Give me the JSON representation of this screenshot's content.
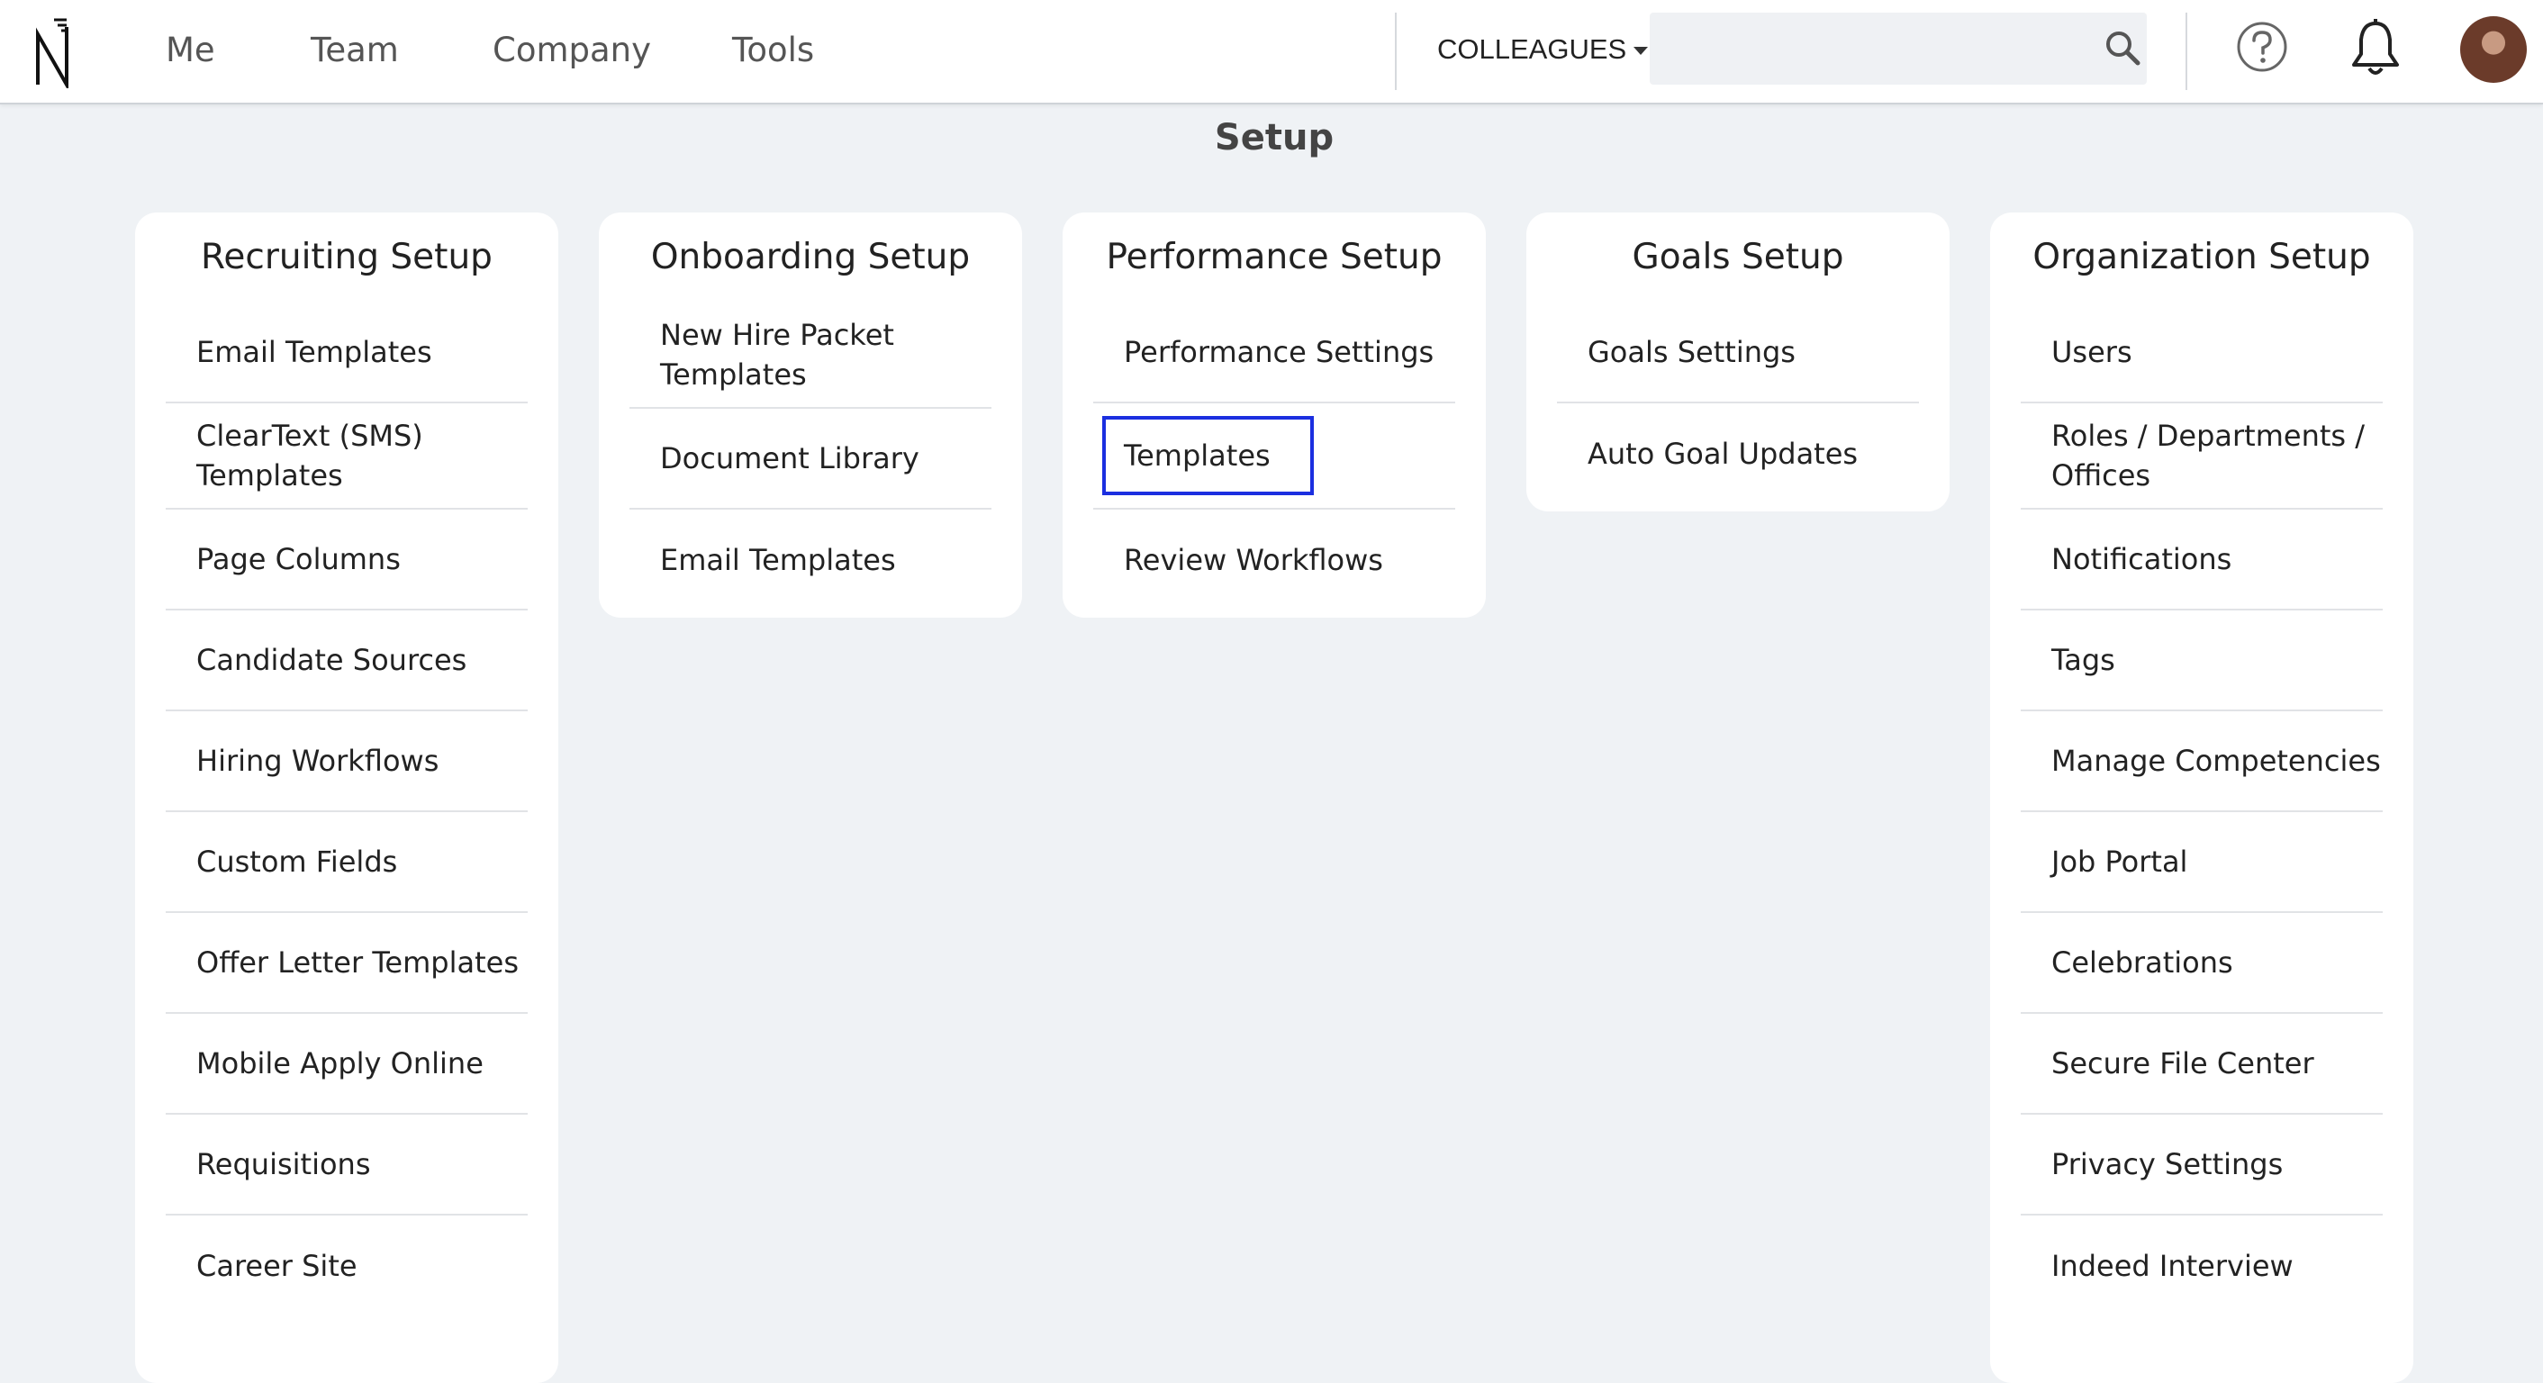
{
  "nav": {
    "items": [
      "Me",
      "Team",
      "Company",
      "Tools"
    ]
  },
  "header": {
    "colleagues_label": "COLLEAGUES",
    "search_placeholder": "",
    "icons": [
      "logo-icon",
      "search-icon",
      "help-icon",
      "bell-icon",
      "avatar"
    ]
  },
  "page": {
    "title": "Setup"
  },
  "columns": [
    {
      "title": "Recruiting Setup",
      "items": [
        "Email Templates",
        "ClearText (SMS) Templates",
        "Page Columns",
        "Candidate Sources",
        "Hiring Workflows",
        "Custom Fields",
        "Offer Letter Templates",
        "Mobile Apply Online",
        "Requisitions",
        "Career Site"
      ]
    },
    {
      "title": "Onboarding Setup",
      "items": [
        "New Hire Packet Templates",
        "Document Library",
        "Email Templates"
      ]
    },
    {
      "title": "Performance Setup",
      "items": [
        "Performance Settings",
        "Templates",
        "Review Workflows"
      ],
      "highlighted_item": "Templates"
    },
    {
      "title": "Goals Setup",
      "items": [
        "Goals Settings",
        "Auto Goal Updates"
      ]
    },
    {
      "title": "Organization Setup",
      "items": [
        "Users",
        "Roles / Departments / Offices",
        "Notifications",
        "Tags",
        "Manage Competencies",
        "Job Portal",
        "Celebrations",
        "Secure File Center",
        "Privacy Settings",
        "Indeed Interview"
      ]
    }
  ],
  "colors": {
    "highlight_border": "#1b2fe0",
    "page_bg": "#eff2f5"
  }
}
